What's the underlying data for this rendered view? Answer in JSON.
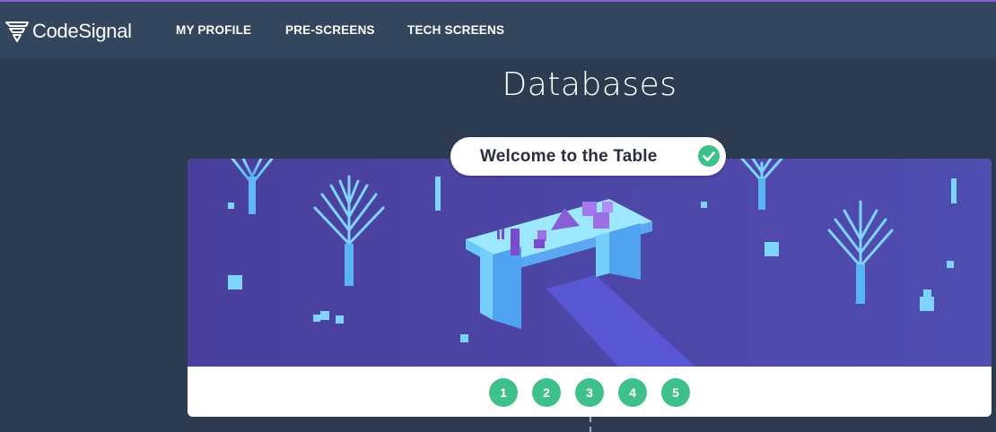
{
  "brand": {
    "name": "CodeSignal",
    "icon": "codesignal-logo-icon"
  },
  "nav": [
    {
      "label": "MY PROFILE"
    },
    {
      "label": "PRE-SCREENS"
    },
    {
      "label": "TECH SCREENS"
    }
  ],
  "page": {
    "title": "Databases"
  },
  "current_topic": {
    "label": "Welcome to the Table",
    "status_icon": "check-circle-icon",
    "completed": true
  },
  "steps": [
    "1",
    "2",
    "3",
    "4",
    "5"
  ],
  "colors": {
    "background": "#2c3b50",
    "navbar": "#34465e",
    "accent_line": "#8a5cd6",
    "scene_bg": "#4b43a1",
    "step": "#3fbf8a"
  }
}
